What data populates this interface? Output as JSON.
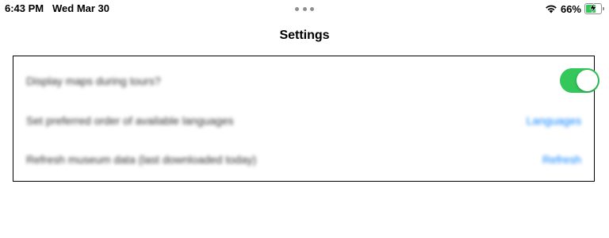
{
  "status_bar": {
    "time": "6:43 PM",
    "date": "Wed Mar 30",
    "battery_text": "66%",
    "battery_level": 0.66,
    "battery_color": "#34c759",
    "wifi_icon": "wifi-icon",
    "battery_icon": "battery-charging-icon"
  },
  "nav": {
    "title": "Settings"
  },
  "settings": {
    "rows": [
      {
        "label": "Display maps during tours?",
        "control": "toggle",
        "toggle_on": true
      },
      {
        "label": "Set preferred order of available languages",
        "control": "link",
        "link_text": "Languages"
      },
      {
        "label": "Refresh museum data (last downloaded today)",
        "control": "link",
        "link_text": "Refresh"
      }
    ]
  },
  "colors": {
    "accent": "#0a84ff",
    "toggle_on": "#34c759"
  }
}
